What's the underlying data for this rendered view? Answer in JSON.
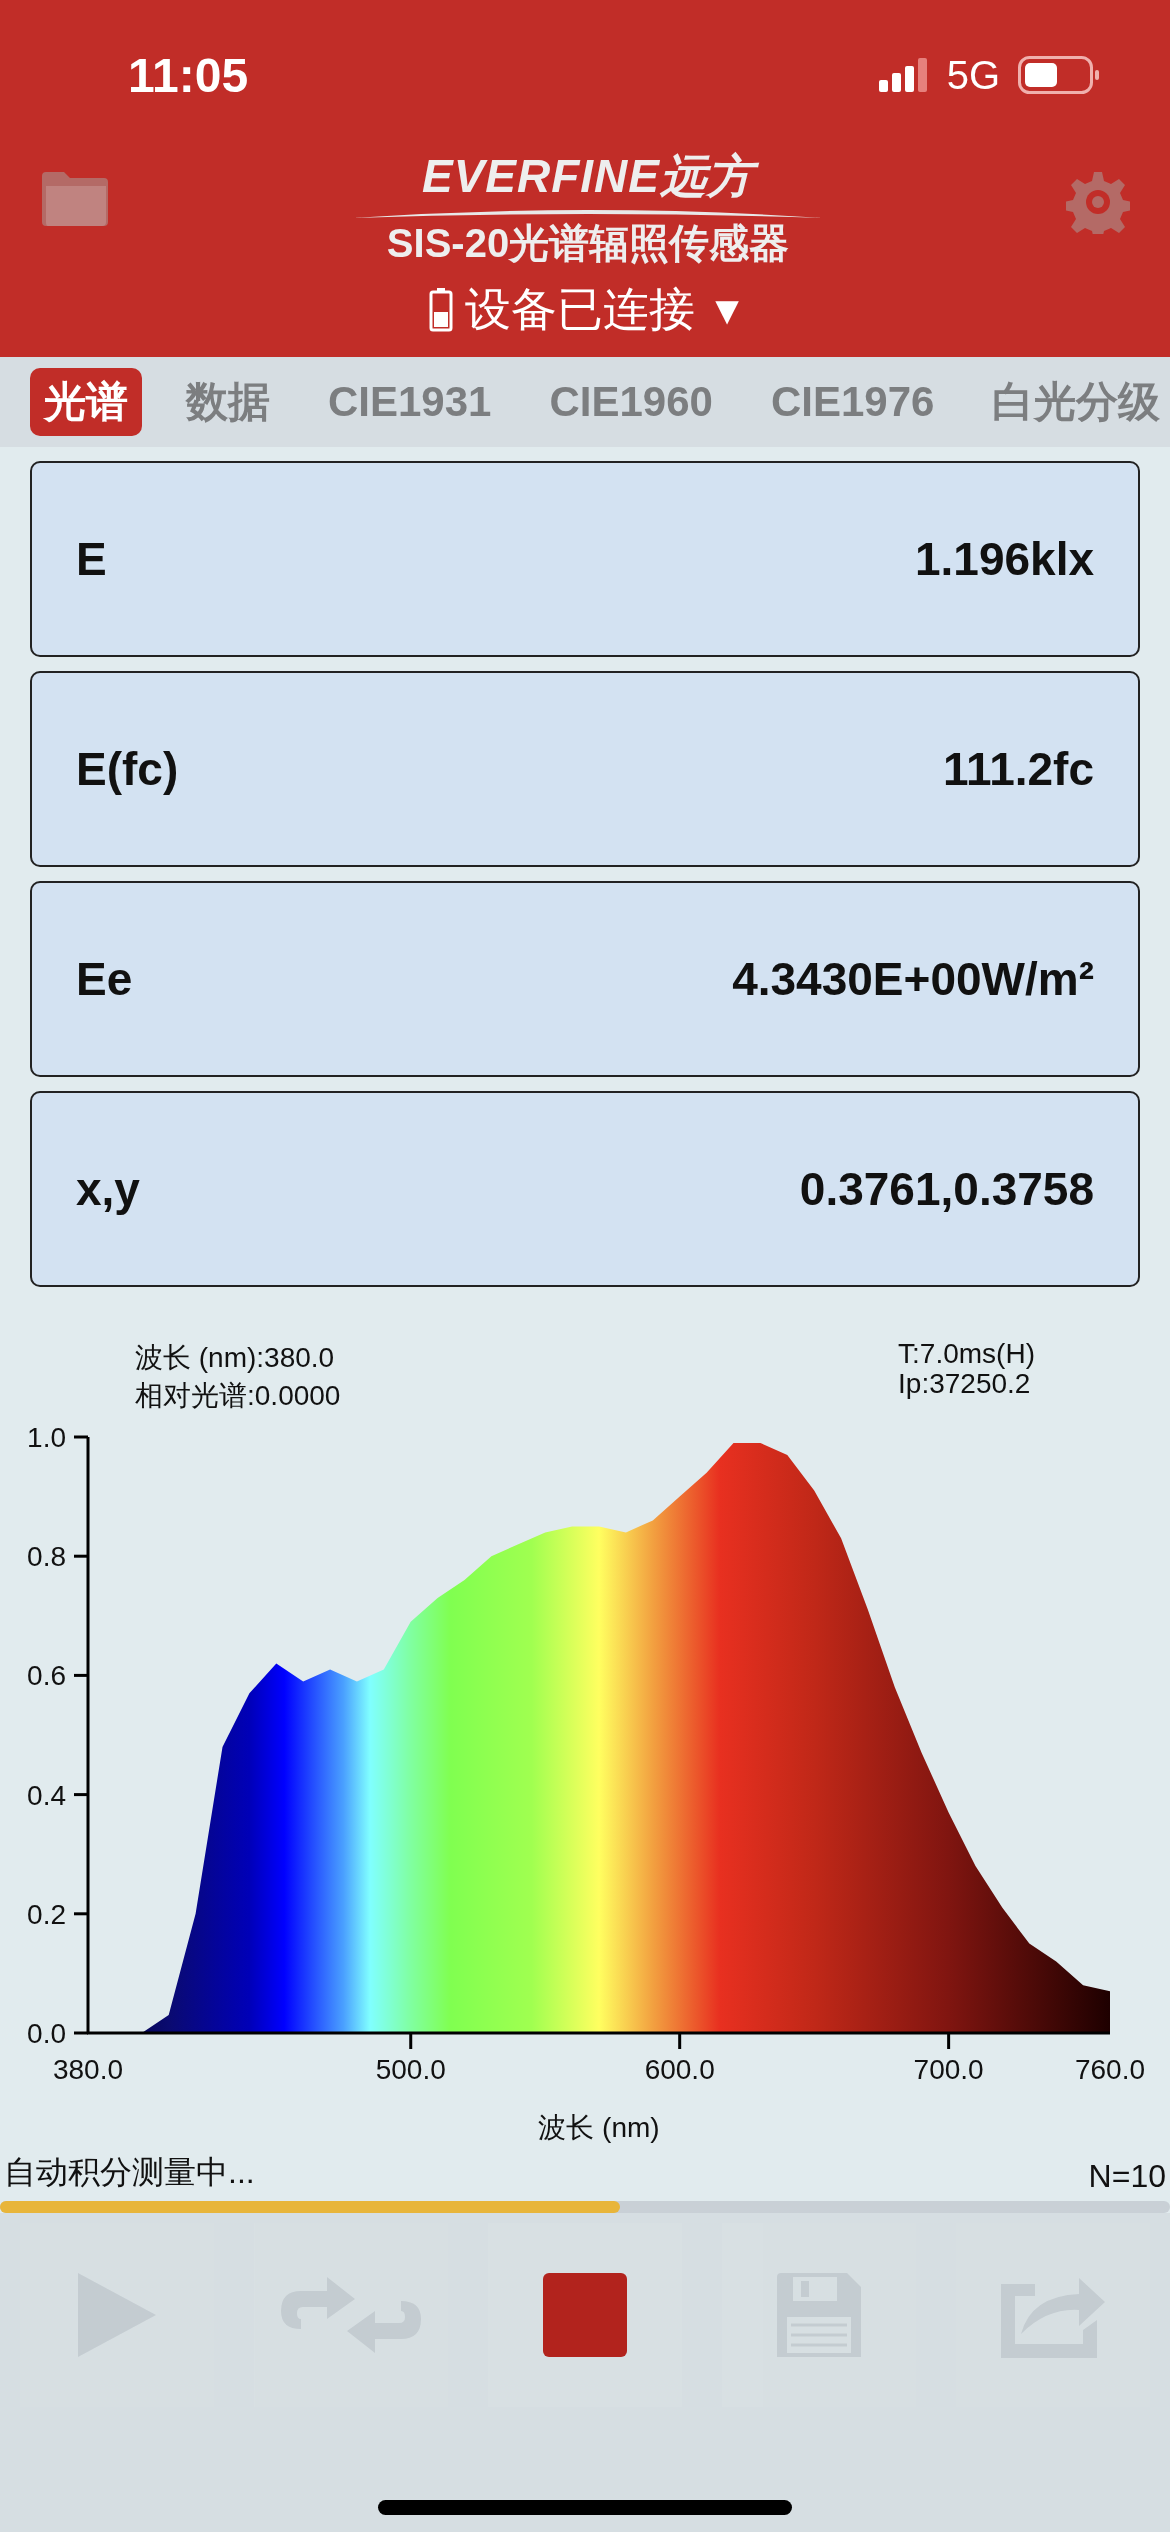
{
  "status_bar": {
    "time": "11:05",
    "network": "5G"
  },
  "header": {
    "logo": "EVERFINE远方",
    "subtitle": "SIS-20光谱辐照传感器",
    "connection": "设备已连接",
    "connection_arrow": "▼"
  },
  "tabs": [
    {
      "label": "光谱",
      "selected": true
    },
    {
      "label": "数据",
      "selected": false
    },
    {
      "label": "CIE1931",
      "selected": false
    },
    {
      "label": "CIE1960",
      "selected": false
    },
    {
      "label": "CIE1976",
      "selected": false
    },
    {
      "label": "白光分级",
      "selected": false
    }
  ],
  "readings": [
    {
      "label": "E",
      "value": "1.196klx"
    },
    {
      "label": "E(fc)",
      "value": "111.2fc"
    },
    {
      "label": "Ee",
      "value": "4.3430E+00W/m²"
    },
    {
      "label": "x,y",
      "value": "0.3761,0.3758"
    }
  ],
  "chart": {
    "cursor_wavelength": "波长 (nm):380.0",
    "cursor_relative": "相对光谱:0.0000",
    "integration_time": "T:7.0ms(H)",
    "peak": "Ip:37250.2",
    "chart_data": {
      "type": "area",
      "xlabel": "波长 (nm)",
      "xlim": [
        380,
        760
      ],
      "ylim": [
        0,
        1
      ],
      "xticks": [
        {
          "value": 380,
          "label": "380.0"
        },
        {
          "value": 500,
          "label": "500.0"
        },
        {
          "value": 600,
          "label": "600.0"
        },
        {
          "value": 700,
          "label": "700.0"
        },
        {
          "value": 760,
          "label": "760.0"
        }
      ],
      "yticks": [
        {
          "value": 0,
          "label": "0.0"
        },
        {
          "value": 0.2,
          "label": "0.2"
        },
        {
          "value": 0.4,
          "label": "0.4"
        },
        {
          "value": 0.6,
          "label": "0.6"
        },
        {
          "value": 0.8,
          "label": "0.8"
        },
        {
          "value": 1,
          "label": "1.0"
        }
      ],
      "x": [
        380,
        390,
        400,
        410,
        420,
        430,
        440,
        450,
        460,
        470,
        480,
        490,
        500,
        510,
        520,
        530,
        540,
        550,
        560,
        570,
        580,
        590,
        600,
        610,
        620,
        630,
        640,
        650,
        660,
        670,
        680,
        690,
        700,
        710,
        720,
        730,
        740,
        750,
        760
      ],
      "values": [
        0,
        0,
        0,
        0.03,
        0.2,
        0.48,
        0.57,
        0.62,
        0.59,
        0.61,
        0.59,
        0.61,
        0.69,
        0.73,
        0.76,
        0.8,
        0.82,
        0.84,
        0.85,
        0.85,
        0.84,
        0.86,
        0.9,
        0.94,
        0.99,
        0.99,
        0.97,
        0.91,
        0.83,
        0.71,
        0.58,
        0.47,
        0.37,
        0.28,
        0.21,
        0.15,
        0.12,
        0.08,
        0.07
      ]
    }
  },
  "measurement": {
    "status": "自动积分测量中...",
    "count": "N=10",
    "level": 0.53
  },
  "toolbar": [
    {
      "kind": "play",
      "disabled": true
    },
    {
      "kind": "loop",
      "disabled": true
    },
    {
      "kind": "stop",
      "disabled": false
    },
    {
      "kind": "save",
      "disabled": true
    },
    {
      "kind": "share",
      "disabled": true
    }
  ]
}
